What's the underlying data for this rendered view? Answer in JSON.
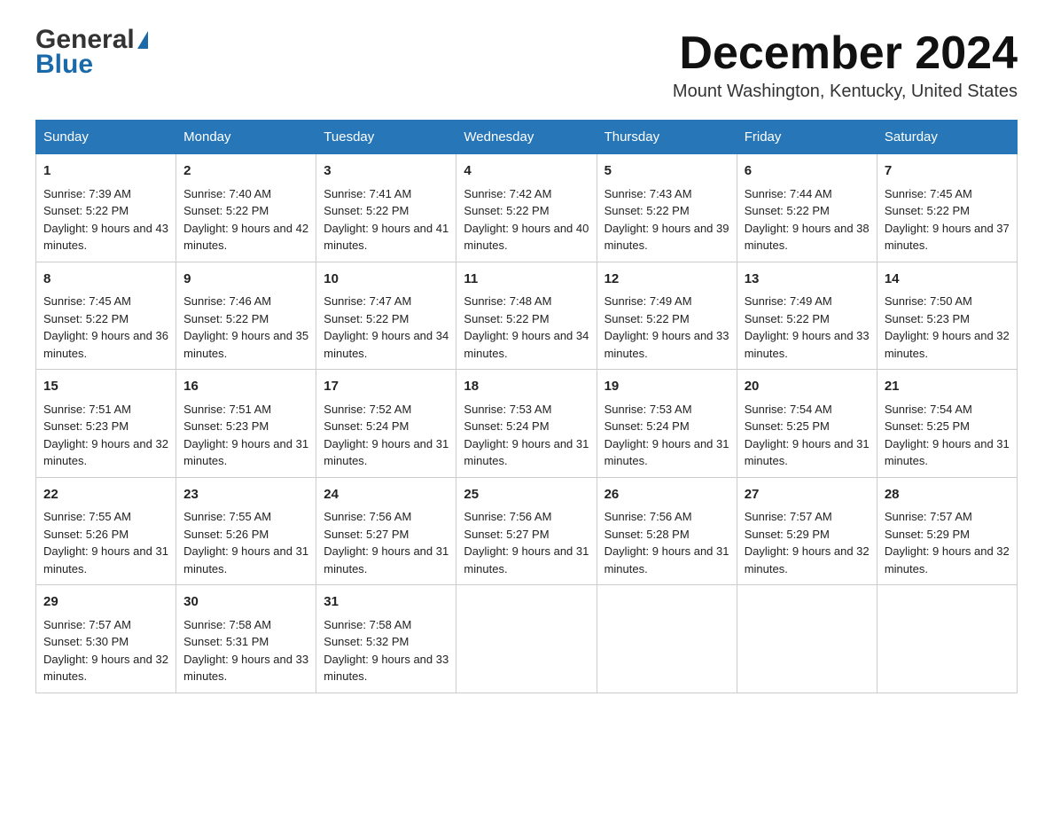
{
  "logo": {
    "general": "General",
    "blue": "Blue"
  },
  "header": {
    "month": "December 2024",
    "location": "Mount Washington, Kentucky, United States"
  },
  "days": [
    "Sunday",
    "Monday",
    "Tuesday",
    "Wednesday",
    "Thursday",
    "Friday",
    "Saturday"
  ],
  "weeks": [
    [
      {
        "num": "1",
        "sunrise": "7:39 AM",
        "sunset": "5:22 PM",
        "daylight": "9 hours and 43 minutes."
      },
      {
        "num": "2",
        "sunrise": "7:40 AM",
        "sunset": "5:22 PM",
        "daylight": "9 hours and 42 minutes."
      },
      {
        "num": "3",
        "sunrise": "7:41 AM",
        "sunset": "5:22 PM",
        "daylight": "9 hours and 41 minutes."
      },
      {
        "num": "4",
        "sunrise": "7:42 AM",
        "sunset": "5:22 PM",
        "daylight": "9 hours and 40 minutes."
      },
      {
        "num": "5",
        "sunrise": "7:43 AM",
        "sunset": "5:22 PM",
        "daylight": "9 hours and 39 minutes."
      },
      {
        "num": "6",
        "sunrise": "7:44 AM",
        "sunset": "5:22 PM",
        "daylight": "9 hours and 38 minutes."
      },
      {
        "num": "7",
        "sunrise": "7:45 AM",
        "sunset": "5:22 PM",
        "daylight": "9 hours and 37 minutes."
      }
    ],
    [
      {
        "num": "8",
        "sunrise": "7:45 AM",
        "sunset": "5:22 PM",
        "daylight": "9 hours and 36 minutes."
      },
      {
        "num": "9",
        "sunrise": "7:46 AM",
        "sunset": "5:22 PM",
        "daylight": "9 hours and 35 minutes."
      },
      {
        "num": "10",
        "sunrise": "7:47 AM",
        "sunset": "5:22 PM",
        "daylight": "9 hours and 34 minutes."
      },
      {
        "num": "11",
        "sunrise": "7:48 AM",
        "sunset": "5:22 PM",
        "daylight": "9 hours and 34 minutes."
      },
      {
        "num": "12",
        "sunrise": "7:49 AM",
        "sunset": "5:22 PM",
        "daylight": "9 hours and 33 minutes."
      },
      {
        "num": "13",
        "sunrise": "7:49 AM",
        "sunset": "5:22 PM",
        "daylight": "9 hours and 33 minutes."
      },
      {
        "num": "14",
        "sunrise": "7:50 AM",
        "sunset": "5:23 PM",
        "daylight": "9 hours and 32 minutes."
      }
    ],
    [
      {
        "num": "15",
        "sunrise": "7:51 AM",
        "sunset": "5:23 PM",
        "daylight": "9 hours and 32 minutes."
      },
      {
        "num": "16",
        "sunrise": "7:51 AM",
        "sunset": "5:23 PM",
        "daylight": "9 hours and 31 minutes."
      },
      {
        "num": "17",
        "sunrise": "7:52 AM",
        "sunset": "5:24 PM",
        "daylight": "9 hours and 31 minutes."
      },
      {
        "num": "18",
        "sunrise": "7:53 AM",
        "sunset": "5:24 PM",
        "daylight": "9 hours and 31 minutes."
      },
      {
        "num": "19",
        "sunrise": "7:53 AM",
        "sunset": "5:24 PM",
        "daylight": "9 hours and 31 minutes."
      },
      {
        "num": "20",
        "sunrise": "7:54 AM",
        "sunset": "5:25 PM",
        "daylight": "9 hours and 31 minutes."
      },
      {
        "num": "21",
        "sunrise": "7:54 AM",
        "sunset": "5:25 PM",
        "daylight": "9 hours and 31 minutes."
      }
    ],
    [
      {
        "num": "22",
        "sunrise": "7:55 AM",
        "sunset": "5:26 PM",
        "daylight": "9 hours and 31 minutes."
      },
      {
        "num": "23",
        "sunrise": "7:55 AM",
        "sunset": "5:26 PM",
        "daylight": "9 hours and 31 minutes."
      },
      {
        "num": "24",
        "sunrise": "7:56 AM",
        "sunset": "5:27 PM",
        "daylight": "9 hours and 31 minutes."
      },
      {
        "num": "25",
        "sunrise": "7:56 AM",
        "sunset": "5:27 PM",
        "daylight": "9 hours and 31 minutes."
      },
      {
        "num": "26",
        "sunrise": "7:56 AM",
        "sunset": "5:28 PM",
        "daylight": "9 hours and 31 minutes."
      },
      {
        "num": "27",
        "sunrise": "7:57 AM",
        "sunset": "5:29 PM",
        "daylight": "9 hours and 32 minutes."
      },
      {
        "num": "28",
        "sunrise": "7:57 AM",
        "sunset": "5:29 PM",
        "daylight": "9 hours and 32 minutes."
      }
    ],
    [
      {
        "num": "29",
        "sunrise": "7:57 AM",
        "sunset": "5:30 PM",
        "daylight": "9 hours and 32 minutes."
      },
      {
        "num": "30",
        "sunrise": "7:58 AM",
        "sunset": "5:31 PM",
        "daylight": "9 hours and 33 minutes."
      },
      {
        "num": "31",
        "sunrise": "7:58 AM",
        "sunset": "5:32 PM",
        "daylight": "9 hours and 33 minutes."
      },
      null,
      null,
      null,
      null
    ]
  ],
  "labels": {
    "sunrise": "Sunrise: ",
    "sunset": "Sunset: ",
    "daylight": "Daylight: "
  }
}
